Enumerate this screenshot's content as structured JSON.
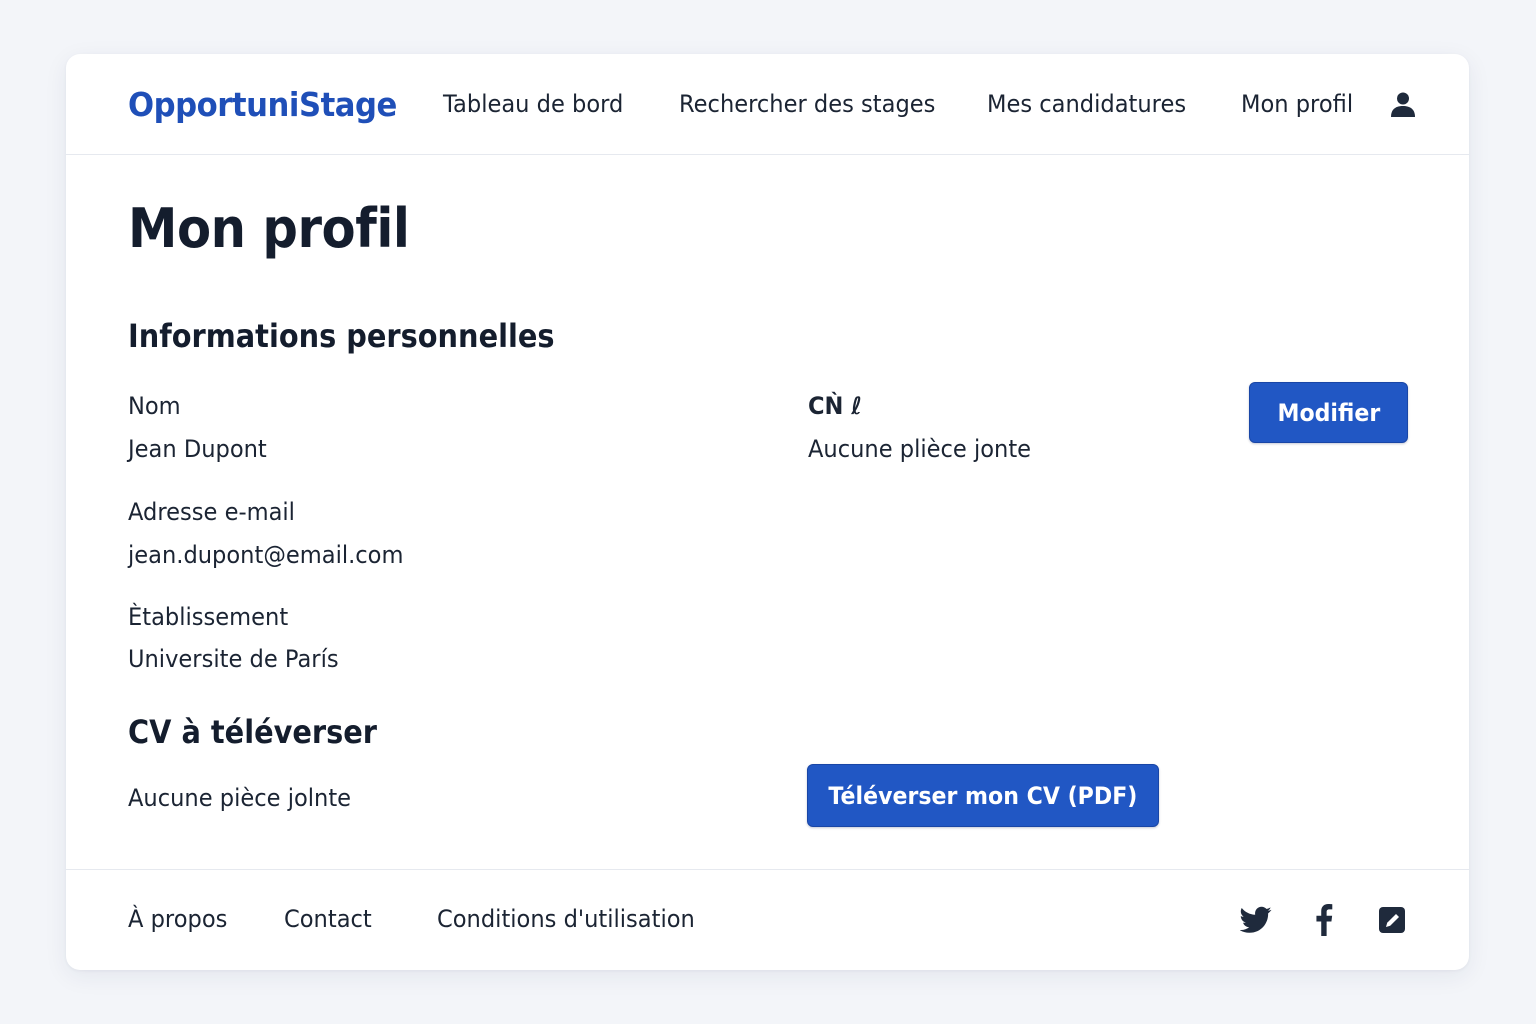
{
  "header": {
    "logo": "OpportuniStage",
    "nav": [
      {
        "label": "Tableau de bord"
      },
      {
        "label": "Rechercher des stages"
      },
      {
        "label": "Mes candidatures"
      },
      {
        "label": "Mon profil"
      }
    ],
    "user_icon": "user-icon"
  },
  "main": {
    "page_title": "Mon profil",
    "personal": {
      "title": "Informations personnelles",
      "name_label": "Nom",
      "name_value": "Jean Dupont",
      "email_label": "Adresse e-mail",
      "email_value": "jean.dupont@email.com",
      "school_label": "Ètablissement",
      "school_value": "Universite de París",
      "cv_label": "CǸ ℓ",
      "cv_value": "Aucune plièce jonte",
      "edit_button": "Modifier"
    },
    "cv_upload": {
      "title": "CV à téléverser",
      "status": "Aucune pièce jolnte",
      "upload_button": "Téléverser mon CV (PDF)"
    }
  },
  "footer": {
    "links": [
      {
        "label": "À propos"
      },
      {
        "label": "Contact"
      },
      {
        "label": "Conditions d'utilisation"
      }
    ],
    "social_icons": [
      "twitter-icon",
      "facebook-icon",
      "edit-square-icon"
    ]
  },
  "colors": {
    "brand": "#1f4fb8",
    "button": "#2157c4",
    "text": "#1b2433",
    "background": "#f3f5f9"
  }
}
